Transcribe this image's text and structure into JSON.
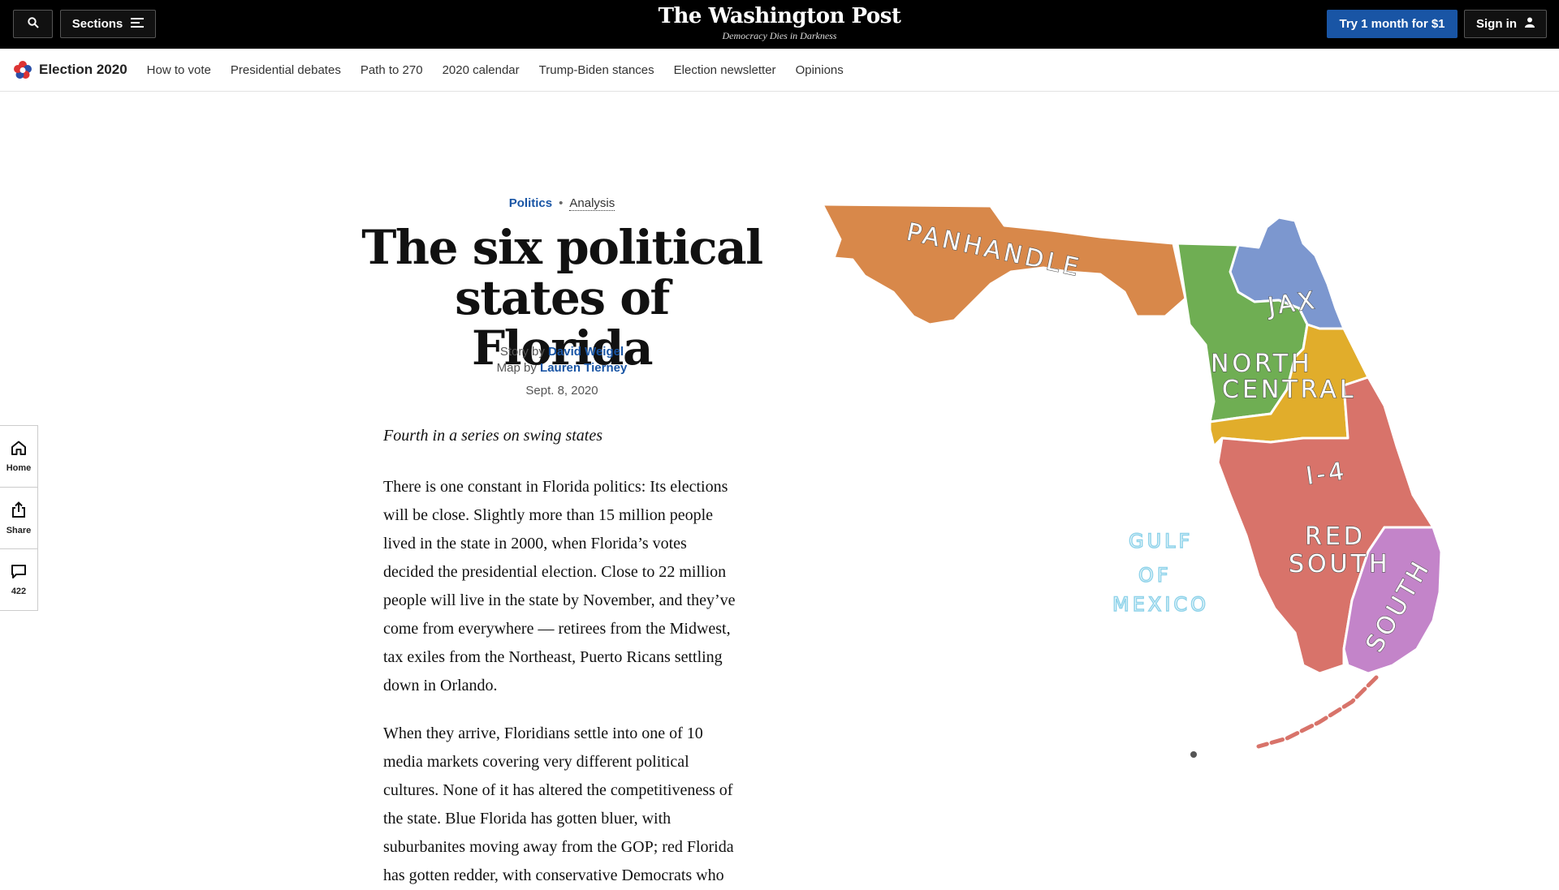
{
  "masthead": {
    "sections_label": "Sections",
    "logo": "The Washington Post",
    "tagline": "Democracy Dies in Darkness",
    "subscribe_label": "Try 1 month for $1",
    "signin_label": "Sign in"
  },
  "election_nav": {
    "title": "Election 2020",
    "links": [
      "How to vote",
      "Presidential debates",
      "Path to 270",
      "2020 calendar",
      "Trump-Biden stances",
      "Election newsletter",
      "Opinions"
    ]
  },
  "rail": {
    "home_label": "Home",
    "share_label": "Share",
    "comments_count": "422"
  },
  "article": {
    "section": "Politics",
    "label": "Analysis",
    "headline": "The six political states of Florida",
    "story_by": "Story by",
    "story_author": "David Weigel",
    "map_by": "Map by",
    "map_author": "Lauren Tierney",
    "date": "Sept. 8, 2020",
    "deck": "Fourth in a series on swing states",
    "paragraphs": [
      "There is one constant in Florida politics: Its elections will be close. Slightly more than 15 million people lived in the state in 2000, when Florida’s votes decided the presidential election. Close to 22 million people will live in the state by November, and they’ve come from everywhere — retirees from the Midwest, tax exiles from the Northeast, Puerto Ricans settling down in Orlando.",
      "When they arrive, Floridians settle into one of 10 media markets covering very different political cultures. None of it has altered the competitiveness of the state. Blue Florida has gotten bluer, with suburbanites moving away from the GOP; red Florida has gotten redder, with conservative Democrats who"
    ]
  },
  "map": {
    "regions": [
      {
        "name": "PANHANDLE",
        "color": "#d8884a"
      },
      {
        "name": "JAX",
        "color": "#7c97cf"
      },
      {
        "name": "NORTH",
        "color": "#6fae53"
      },
      {
        "name": "CENTRAL",
        "color": "#6fae53"
      },
      {
        "name": "I-4",
        "color": "#e1ad2b"
      },
      {
        "name": "RED",
        "color": "#d8736a"
      },
      {
        "name": "SOUTH",
        "color": "#d8736a"
      },
      {
        "name": "SOUTH",
        "color": "#c384c9"
      }
    ],
    "gulf_lines": [
      "GULF",
      "OF",
      "MEXICO"
    ]
  },
  "colors": {
    "accent": "#1955a5",
    "masthead_bg": "#000000"
  }
}
